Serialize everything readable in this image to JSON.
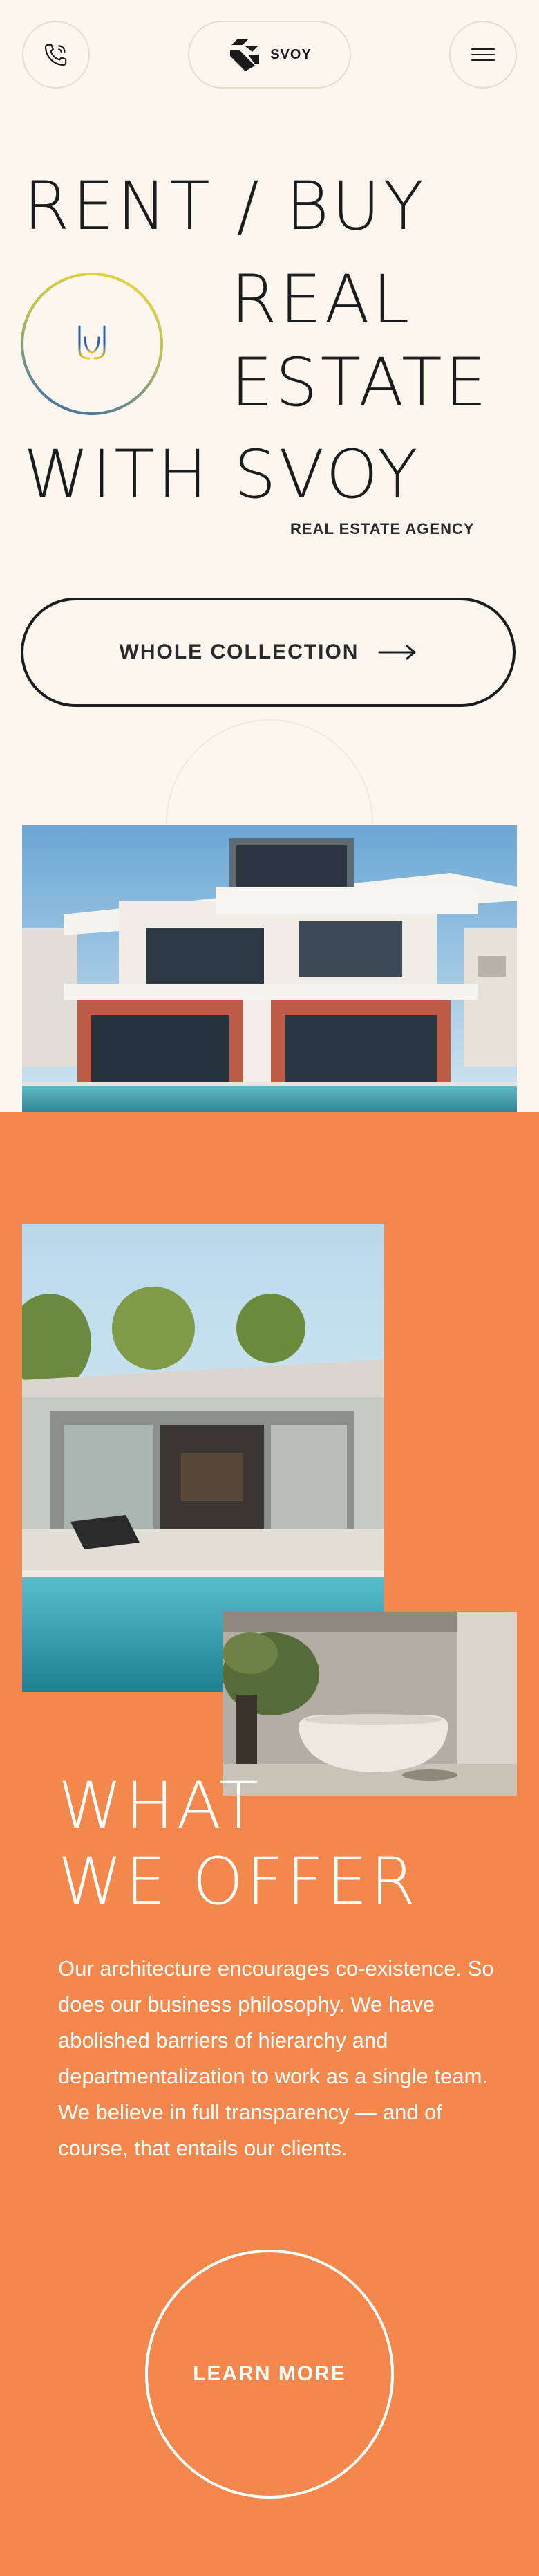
{
  "header": {
    "phone_icon": "phone-icon",
    "logo_text": "SVOY",
    "menu_icon": "hamburger-menu-icon"
  },
  "hero": {
    "line1": "RENT / BUY",
    "line2": "REAL",
    "line3": "ESTATE",
    "line4": "WITH SVOY",
    "tagline": "REAL ESTATE AGENCY",
    "emblem_icon": "ukraine-trident-icon",
    "cta_label": "WHOLE COLLECTION",
    "cta_icon": "arrow-right-icon"
  },
  "offer": {
    "title_line1": "WHAT",
    "title_line2": "WE OFFER",
    "description": "Our architecture encourages co-existence. So does our business philosophy. We have abolished barriers of hierarchy and departmentalization to work as a single team. We believe in full transparency — and of course, that entails our clients.",
    "cta_label": "LEARN MORE"
  },
  "colors": {
    "background": "#fcf6ee",
    "accent_orange": "#f4874b",
    "text_dark": "#1e1e1e",
    "emblem_blue": "#2d62b3",
    "emblem_yellow": "#f2d632"
  }
}
